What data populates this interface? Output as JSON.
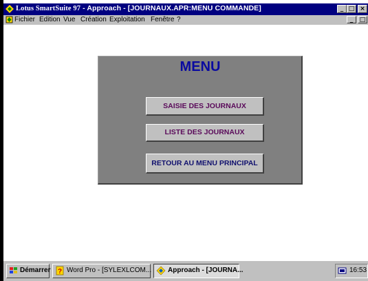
{
  "window": {
    "title_brand": "Lotus SmartSuite 97",
    "title_rest": "  -  Approach - [JOURNAUX.APR:MENU COMMANDE]"
  },
  "menubar": {
    "items": [
      {
        "label": "Fichier"
      },
      {
        "label": "Edition"
      },
      {
        "label": "Vue"
      },
      {
        "label": "Création"
      },
      {
        "label": "Exploitation"
      },
      {
        "label": "Fenêtre"
      },
      {
        "label": "?"
      }
    ]
  },
  "form": {
    "title": "MENU",
    "buttons": {
      "saisie": "SAISIE DES JOURNAUX",
      "liste": "LISTE DES JOURNAUX",
      "retour": "RETOUR AU MENU PRINCIPAL"
    },
    "colors": {
      "panel": "#808080",
      "title": "#0a0aa0",
      "button_text": "#5a0a5a"
    }
  },
  "taskbar": {
    "start_label": "Démarrer",
    "tasks": [
      {
        "label": "Word Pro - [SYLEXLCOM...",
        "icon": "word-pro-icon"
      },
      {
        "label": "Approach - [JOURNA...",
        "icon": "approach-icon"
      }
    ],
    "clock": "16:53"
  },
  "colors": {
    "titlebar": "#000080",
    "chrome": "#c0c0c0"
  }
}
